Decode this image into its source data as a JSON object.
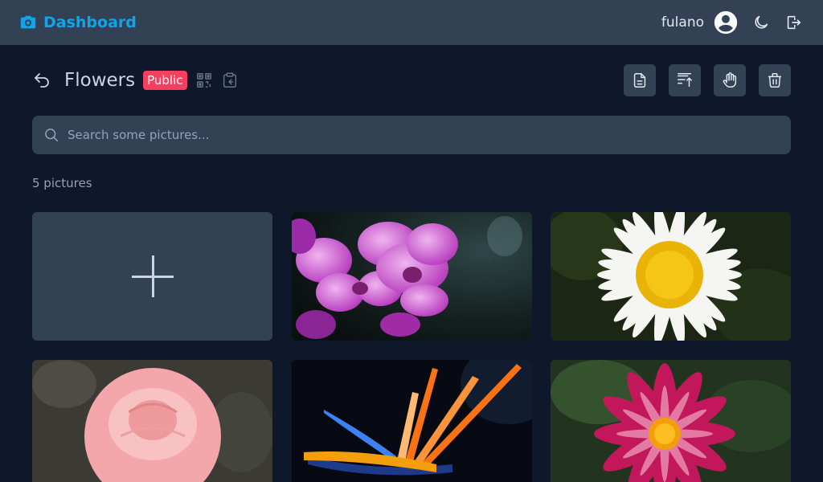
{
  "nav": {
    "brand_title": "Dashboard",
    "username": "fulano",
    "accent": "#0ea5e9"
  },
  "album": {
    "title": "Flowers",
    "visibility_badge": "Public",
    "badge_color": "#f43f5e"
  },
  "search": {
    "placeholder": "Search some pictures..."
  },
  "gallery": {
    "count_text": "5 pictures",
    "pictures": [
      {
        "subject": "purple orchids"
      },
      {
        "subject": "white daisy"
      },
      {
        "subject": "pink rose"
      },
      {
        "subject": "bird of paradise"
      },
      {
        "subject": "pink dahlia"
      }
    ]
  },
  "icons": {
    "brand": "camera-icon",
    "user": "user-circle-icon",
    "theme": "moon-icon",
    "logout": "logout-icon",
    "back": "undo-arrow-icon",
    "qr": "qr-code-icon",
    "copy": "clipboard-icon",
    "toolbar": [
      "file-icon",
      "sort-icon",
      "hand-icon",
      "trash-icon"
    ],
    "search": "search-icon",
    "add": "plus-icon"
  }
}
